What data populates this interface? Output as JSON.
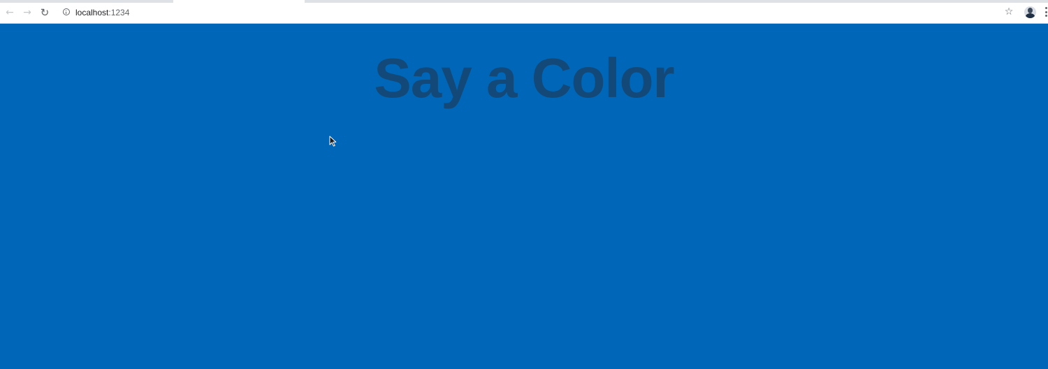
{
  "browser": {
    "url_host": "localhost",
    "url_port": ":1234",
    "back_icon": "arrow-left-icon",
    "forward_icon": "arrow-right-icon",
    "reload_icon": "reload-icon",
    "info_icon": "info-icon",
    "bookmark_icon": "star-icon",
    "profile_icon": "avatar-icon",
    "menu_icon": "kebab-menu-icon"
  },
  "page": {
    "title": "Say a Color",
    "background_color": "#0066b7",
    "title_color": "#124978"
  }
}
